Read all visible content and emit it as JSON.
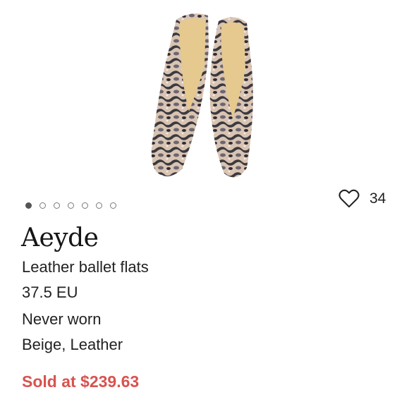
{
  "product": {
    "brand": "Aeyde",
    "title": "Leather ballet flats",
    "size": "37.5 EU",
    "condition": "Never worn",
    "color_material": "Beige, Leather",
    "sold_price": "Sold at $239.63"
  },
  "carousel": {
    "total_images": 7,
    "active_index": 0
  },
  "likes": {
    "count": "34",
    "icon": "heart-outline-icon"
  },
  "colors": {
    "sold_price": "#d8534f",
    "text": "#222222",
    "dot_active": "#555555"
  }
}
